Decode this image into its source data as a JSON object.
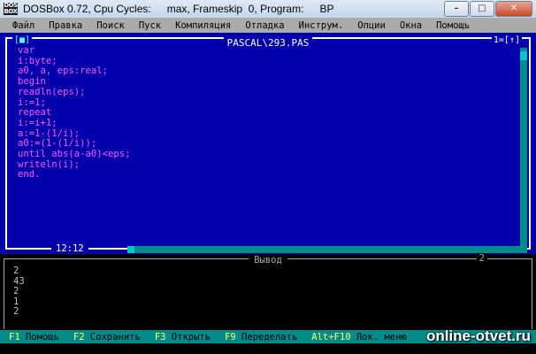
{
  "window": {
    "title_app": "DOSBox 0.72, Cpu Cycles:",
    "title_status": "max, Frameskip  0, Program:",
    "title_program": "BP",
    "icon_text": "DOS BOX",
    "minimize": "–",
    "maximize": "□",
    "close": "✕"
  },
  "menu": [
    "Файл",
    "Правка",
    "Поиск",
    "Пуск",
    "Компиляция",
    "Отладка",
    "Инструм.",
    "Опции",
    "Окна",
    "Помощь"
  ],
  "editor": {
    "filename": "PASCAL\\293.PAS",
    "close_box": "[■]",
    "window_number": "1=[↑]",
    "cursor_position": "12:12",
    "code": [
      "var",
      "i:byte;",
      "a0, a, eps:real;",
      "begin",
      "readln(eps);",
      "i:=1;",
      "repeat",
      "i:=i+1;",
      "a:=1-(1/i);",
      "a0:=(1-(1/i));",
      "until abs(a-a0)<eps;",
      "writeln(i);",
      "end."
    ]
  },
  "output": {
    "title": "Вывод",
    "window_number": "2",
    "lines": [
      "2",
      "43",
      "2",
      "1",
      "2"
    ]
  },
  "hotkeys": [
    {
      "key": "F1",
      "label": "Помощь"
    },
    {
      "key": "F2",
      "label": "Сохранить"
    },
    {
      "key": "F3",
      "label": "Открыть"
    },
    {
      "key": "F9",
      "label": "Переделать"
    },
    {
      "key": "Alt+F10",
      "label": "Лок. меню"
    }
  ],
  "watermark": "online-otvet.ru",
  "colors": {
    "editor_bg": "#0000aa",
    "code_text": "#ff55ff",
    "menu_bg": "#aaaaaa",
    "statusbar_bg": "#008b8b",
    "hotkey": "#ffff55"
  }
}
